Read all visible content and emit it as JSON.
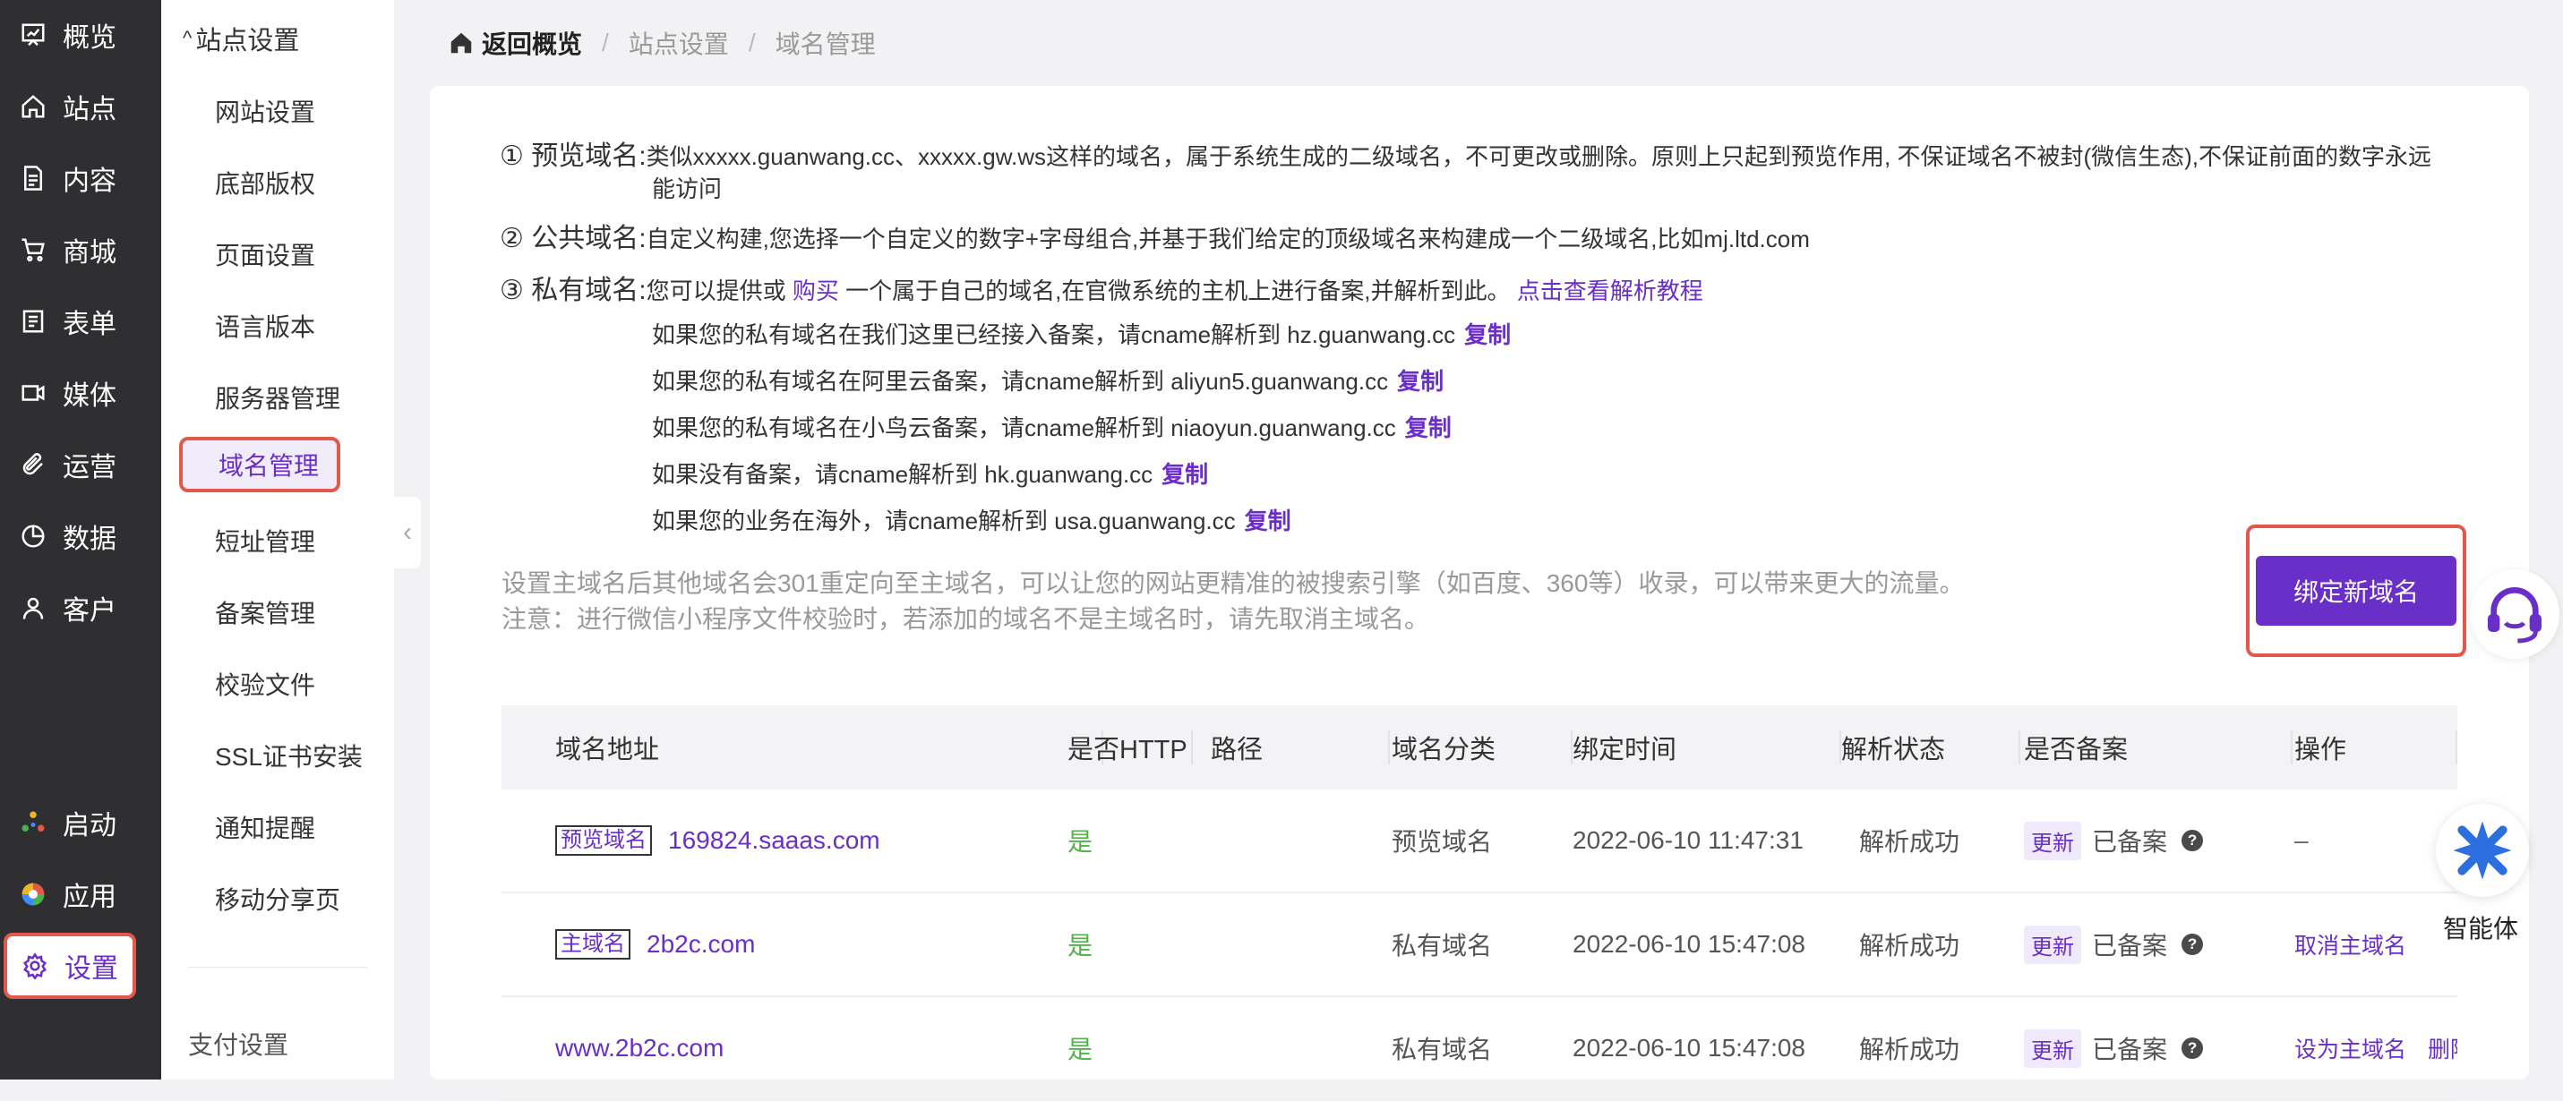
{
  "nav": {
    "items": [
      {
        "label": "概览",
        "icon": "overview-icon"
      },
      {
        "label": "站点",
        "icon": "home-icon"
      },
      {
        "label": "内容",
        "icon": "document-icon"
      },
      {
        "label": "商城",
        "icon": "cart-icon"
      },
      {
        "label": "表单",
        "icon": "form-icon"
      },
      {
        "label": "媒体",
        "icon": "video-icon"
      },
      {
        "label": "运营",
        "icon": "clip-icon"
      },
      {
        "label": "数据",
        "icon": "pie-chart-icon"
      },
      {
        "label": "客户",
        "icon": "user-icon"
      }
    ],
    "bottom": [
      {
        "label": "启动",
        "icon": "launch-icon"
      },
      {
        "label": "应用",
        "icon": "apps-icon"
      },
      {
        "label": "设置",
        "icon": "gear-icon"
      }
    ]
  },
  "submenu": {
    "title": "站点设置",
    "items": [
      "网站设置",
      "底部版权",
      "页面设置",
      "语言版本",
      "服务器管理",
      "域名管理",
      "短址管理",
      "备案管理",
      "校验文件",
      "SSL证书安装",
      "通知提醒",
      "移动分享页"
    ],
    "next_group": "支付设置"
  },
  "breadcrumb": {
    "home": "返回概览",
    "items": [
      "站点设置",
      "域名管理"
    ]
  },
  "info": {
    "preview": {
      "label": "① 预览域名:",
      "text": "类似xxxxx.guanwang.cc、xxxxx.gw.ws这样的域名，属于系统生成的二级域名，不可更改或删除。原则上只起到预览作用, 不保证域名不被封(微信生态),不保证前面的数字永远",
      "text2": "能访问"
    },
    "public": {
      "label": "② 公共域名:",
      "text": "自定义构建,您选择一个自定义的数字+字母组合,并基于我们给定的顶级域名来构建成一个二级域名,比如mj.ltd.com"
    },
    "private": {
      "label": "③ 私有域名:",
      "text_a": "您可以提供或",
      "buy_link": "购买",
      "text_b": "一个属于自己的域名,在官微系统的主机上进行备案,并解析到此。",
      "tutorial_link": "点击查看解析教程"
    },
    "cname_lines": [
      "如果您的私有域名在我们这里已经接入备案，请cname解析到 hz.guanwang.cc",
      "如果您的私有域名在阿里云备案，请cname解析到 aliyun5.guanwang.cc",
      "如果您的私有域名在小鸟云备案，请cname解析到 niaoyun.guanwang.cc",
      "如果没有备案，请cname解析到 hk.guanwang.cc",
      "如果您的业务在海外，请cname解析到 usa.guanwang.cc"
    ],
    "copy_label": "复制",
    "note1": "设置主域名后其他域名会301重定向至主域名，可以让您的网站更精准的被搜索引擎（如百度、360等）收录，可以带来更大的流量。",
    "note2": "注意：进行微信小程序文件校验时，若添加的域名不是主域名时，请先取消主域名。"
  },
  "bind_button": "绑定新域名",
  "table": {
    "columns": [
      "域名地址",
      "是否HTTP",
      "路径",
      "域名分类",
      "绑定时间",
      "解析状态",
      "是否备案",
      "操作"
    ],
    "rows": [
      {
        "tag": "预览域名",
        "domain": "169824.saaas.com",
        "https": "是",
        "path": "",
        "category": "预览域名",
        "time": "2022-06-10 11:47:31",
        "status": "解析成功",
        "update": "更新",
        "icp": "已备案",
        "ops": [
          "–"
        ]
      },
      {
        "tag": "主域名",
        "domain": "2b2c.com",
        "https": "是",
        "path": "",
        "category": "私有域名",
        "time": "2022-06-10 15:47:08",
        "status": "解析成功",
        "update": "更新",
        "icp": "已备案",
        "ops": [
          "取消主域名"
        ]
      },
      {
        "tag": "",
        "domain": "www.2b2c.com",
        "https": "是",
        "path": "",
        "category": "私有域名",
        "time": "2022-06-10 15:47:08",
        "status": "解析成功",
        "update": "更新",
        "icp": "已备案",
        "ops": [
          "设为主域名",
          "删除"
        ]
      }
    ]
  },
  "agent_label": "智能体",
  "colors": {
    "accent": "#6a2fc8",
    "highlight": "#e4574d",
    "nav_bg": "#2f2f31",
    "success": "#52b34a"
  }
}
